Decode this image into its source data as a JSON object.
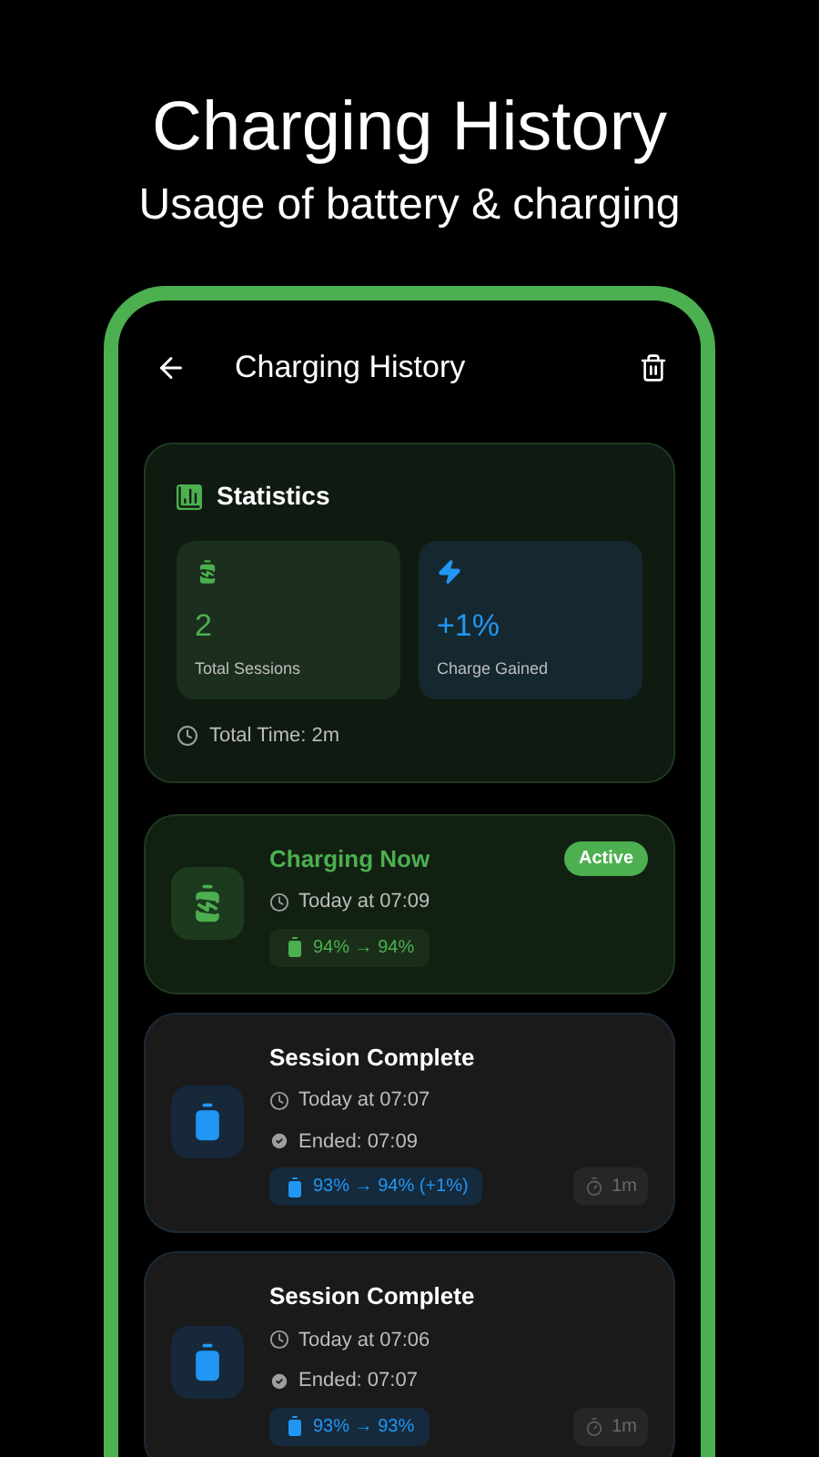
{
  "promo": {
    "title": "Charging History",
    "subtitle": "Usage of battery & charging"
  },
  "app_bar": {
    "title": "Charging History"
  },
  "statistics": {
    "title": "Statistics",
    "tiles": [
      {
        "kind": "sessions",
        "value": "2",
        "label": "Total Sessions"
      },
      {
        "kind": "charge",
        "value": "+1%",
        "label": "Charge Gained"
      }
    ],
    "total_time": "Total Time: 2m"
  },
  "sessions": [
    {
      "kind": "active",
      "title": "Charging Now",
      "badge": "Active",
      "time": "Today at 07:09",
      "charge": "94% → 94%"
    },
    {
      "kind": "complete",
      "title": "Session Complete",
      "time": "Today at 07:07",
      "ended": "Ended: 07:09",
      "charge": "93% → 94% (+1%)",
      "duration": "1m"
    },
    {
      "kind": "complete",
      "title": "Session Complete",
      "time": "Today at 07:06",
      "ended": "Ended: 07:07",
      "charge": "93% → 93%",
      "duration": "1m"
    }
  ]
}
